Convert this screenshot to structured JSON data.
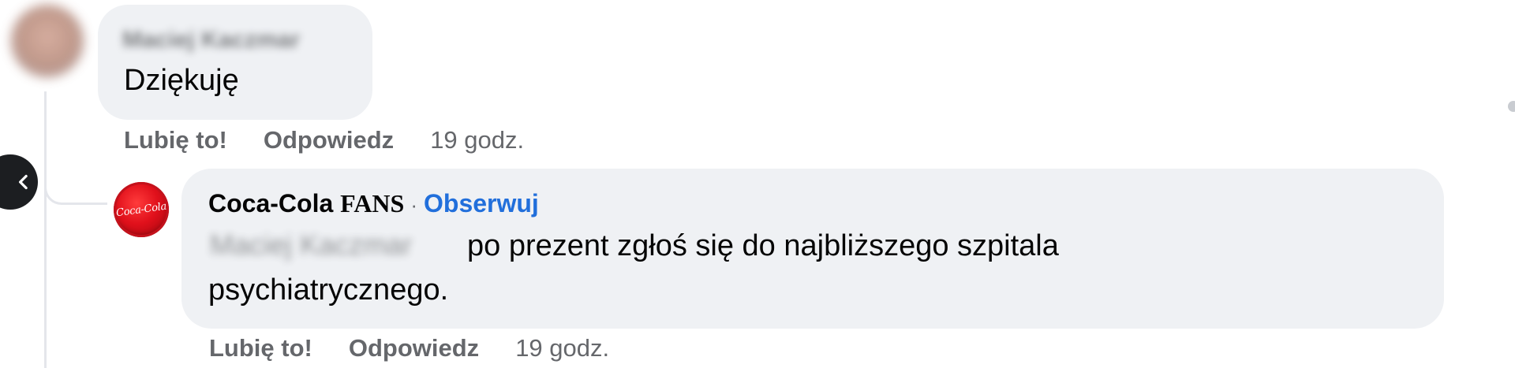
{
  "comment1": {
    "author": "Maciej Kaczmar",
    "text": "Dziękuję",
    "actions": {
      "like": "Lubię to!",
      "reply": "Odpowiedz",
      "time": "19 godz."
    }
  },
  "comment2": {
    "author_name": "Coca-Cola",
    "author_suffix": "FANS",
    "separator": "·",
    "follow_label": "Obserwuj",
    "mention": "Maciej Kaczmar",
    "text_line1": "po prezent zgłoś się do najbliższego szpitala",
    "text_line2": "psychiatrycznego.",
    "avatar_logo": "Coca-Cola",
    "actions": {
      "like": "Lubię to!",
      "reply": "Odpowiedz",
      "time": "19 godz."
    }
  },
  "icons": {
    "nav": "chevron-left-icon"
  },
  "colors": {
    "bubble": "#eff1f4",
    "link_blue": "#216fdb",
    "meta_gray": "#65676b",
    "brand_red": "#e0101b"
  }
}
